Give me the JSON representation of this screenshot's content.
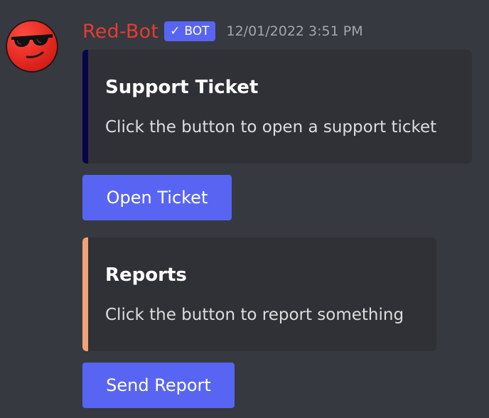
{
  "message": {
    "author": "Red-Bot",
    "bot_tag": {
      "check": "✓",
      "label": "BOT"
    },
    "timestamp": "12/01/2022 3:51 PM",
    "avatar_icon": "red-emoji-sunglasses-icon"
  },
  "embeds": [
    {
      "title": "Support Ticket",
      "description": "Click the button to open a support ticket",
      "accent_color": "#060647"
    },
    {
      "title": "Reports",
      "description": "Click the button to report something",
      "accent_color": "#f0a27a"
    }
  ],
  "buttons": [
    {
      "label": "Open Ticket"
    },
    {
      "label": "Send Report"
    }
  ],
  "colors": {
    "background": "#36393f",
    "embed_background": "#2f3136",
    "username": "#e33d33",
    "blurple": "#5865f2"
  }
}
